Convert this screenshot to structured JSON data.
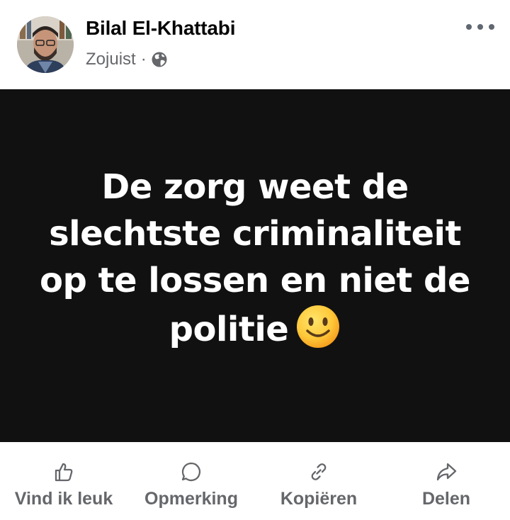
{
  "post": {
    "author": "Bilal El-Khattabi",
    "timestamp": "Zojuist",
    "separator": "·",
    "privacy_icon": "globe-icon",
    "text": "De zorg weet de slechtste criminaliteit op te lossen en niet de politie",
    "emoji": "slightly-smiling-face",
    "background_color": "#111111",
    "text_color": "#ffffff"
  },
  "actions": {
    "like": "Vind ik leuk",
    "comment": "Opmerking",
    "copy": "Kopiëren",
    "share": "Delen"
  },
  "icons": {
    "more": "more-horizontal-icon",
    "like": "thumbs-up-icon",
    "comment": "comment-icon",
    "copy": "link-icon",
    "share": "share-arrow-icon"
  },
  "colors": {
    "secondary_text": "#65676b",
    "primary_text": "#050505"
  }
}
